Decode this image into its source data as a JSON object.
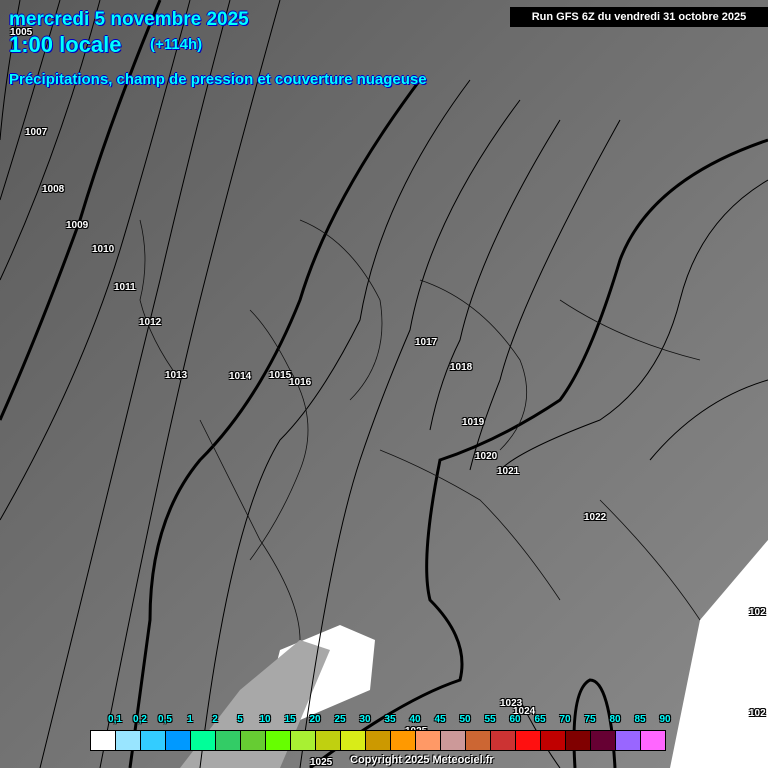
{
  "header": {
    "date": "mercredi 5 novembre 2025",
    "time": "1:00 locale",
    "lead": "(+114h)",
    "subtitle": "Précipitations, champ de pression et couverture nuageuse",
    "run": "Run GFS 6Z du vendredi 31 octobre 2025"
  },
  "isobars": [
    "1005",
    "1007",
    "1008",
    "1009",
    "1010",
    "1011",
    "1012",
    "1013",
    "1014",
    "1015",
    "1016",
    "1017",
    "1018",
    "1019",
    "1020",
    "1021",
    "1022",
    "1023",
    "1024",
    "1025",
    "1025",
    "102",
    "102"
  ],
  "legend": {
    "labels": [
      "0,1",
      "0,2",
      "0,5",
      "1",
      "2",
      "5",
      "10",
      "15",
      "20",
      "25",
      "30",
      "35",
      "40",
      "45",
      "50",
      "55",
      "60",
      "65",
      "70",
      "75",
      "80",
      "85",
      "90"
    ],
    "colors": [
      "#ffffff",
      "#99e5ff",
      "#33ccff",
      "#0099ff",
      "#00ff99",
      "#33cc66",
      "#66cc33",
      "#66ff00",
      "#a8f033",
      "#c0d010",
      "#d8ec18",
      "#cc9900",
      "#ff9900",
      "#ff9966",
      "#cc9999",
      "#cc6633",
      "#cc3333",
      "#ff1010",
      "#c00000",
      "#800000",
      "#660033",
      "#9966ff",
      "#ff66ff"
    ]
  },
  "copyright": "Copyright 2025 Meteociel.fr"
}
